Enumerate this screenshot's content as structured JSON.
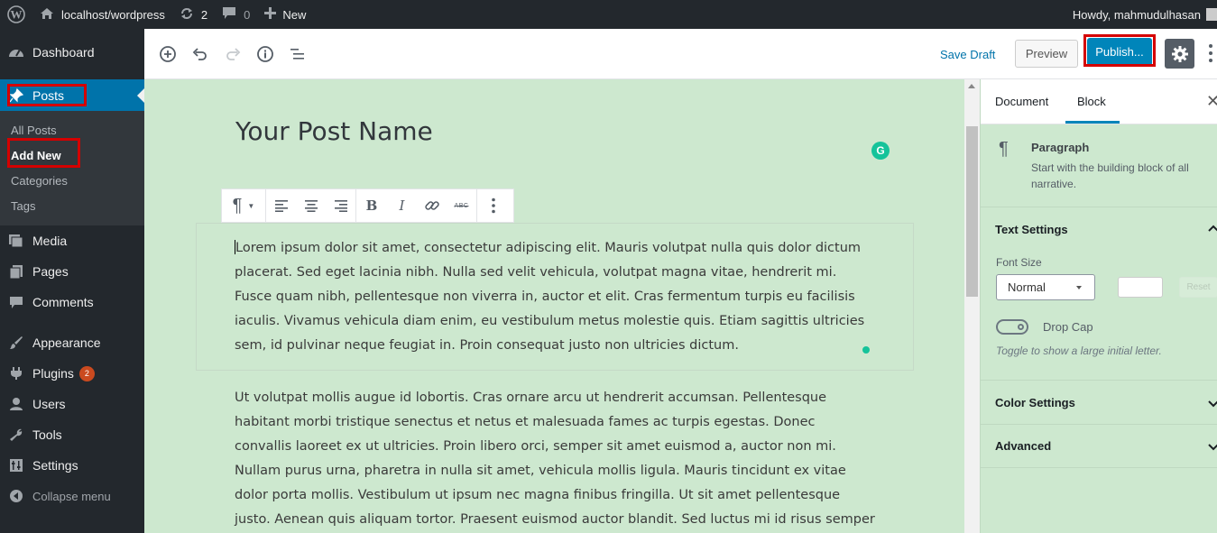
{
  "admin_bar": {
    "site_name": "localhost/wordpress",
    "updates_count": "2",
    "comments_count": "0",
    "new_label": "New",
    "greeting": "Howdy, mahmudulhasan"
  },
  "sidebar": {
    "dashboard": "Dashboard",
    "posts": "Posts",
    "submenu": [
      "All Posts",
      "Add New",
      "Categories",
      "Tags"
    ],
    "media": "Media",
    "pages": "Pages",
    "comments": "Comments",
    "appearance": "Appearance",
    "plugins": "Plugins",
    "plugins_badge": "2",
    "users": "Users",
    "tools": "Tools",
    "settings": "Settings",
    "collapse": "Collapse menu"
  },
  "toolbar": {
    "save_draft": "Save Draft",
    "preview": "Preview",
    "publish": "Publish..."
  },
  "editor": {
    "title": "Your Post Name",
    "grammarly_letter": "G",
    "paragraphs": [
      "Lorem ipsum dolor sit amet, consectetur adipiscing elit. Mauris volutpat nulla quis dolor dictum placerat. Sed eget lacinia nibh. Nulla sed velit vehicula, volutpat magna vitae, hendrerit mi. Fusce quam nibh, pellentesque non viverra in, auctor et elit. Cras fermentum turpis eu facilisis iaculis. Vivamus vehicula diam enim, eu vestibulum metus molestie quis. Etiam sagittis ultricies sem, id pulvinar neque feugiat in. Proin consequat justo non ultricies dictum.",
      "Ut volutpat mollis augue id lobortis. Cras ornare arcu ut hendrerit accumsan. Pellentesque habitant morbi tristique senectus et netus et malesuada fames ac turpis egestas. Donec convallis laoreet ex ut ultricies. Proin libero orci, semper sit amet euismod a, auctor non mi. Nullam purus urna, pharetra in nulla sit amet, vehicula mollis ligula. Mauris tincidunt ex vitae dolor porta mollis. Vestibulum ut ipsum nec magna finibus fringilla. Ut sit amet pellentesque justo. Aenean quis aliquam tortor. Praesent euismod auctor blandit. Sed luctus mi id risus semper dictum. Suspendisse tempus tortor at accumsan pellentesque."
    ],
    "block_toolbar": {
      "strikethrough_label": "ABC"
    }
  },
  "settings_panel": {
    "tabs": [
      "Document",
      "Block"
    ],
    "active_tab": "Block",
    "block_name": "Paragraph",
    "block_description": "Start with the building block of all narrative.",
    "text_settings": "Text Settings",
    "font_size_label": "Font Size",
    "font_size_value": "Normal",
    "reset_label": "Reset",
    "drop_cap_label": "Drop Cap",
    "drop_cap_help": "Toggle to show a large initial letter.",
    "color_settings": "Color Settings",
    "advanced": "Advanced"
  },
  "colors": {
    "admin_dark": "#23282d",
    "accent_blue": "#0073aa",
    "publish_blue": "#0085ba",
    "canvas_green": "#cde8cf",
    "highlight_red": "#d50000",
    "grammarly_green": "#15c39a"
  }
}
